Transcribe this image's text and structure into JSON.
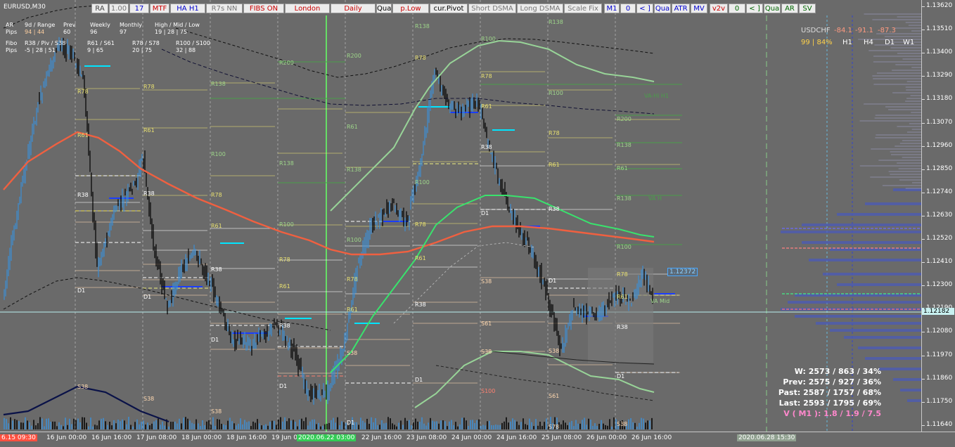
{
  "symbol": {
    "label": "EURUSD,M30"
  },
  "toolbar": [
    {
      "label": "RA",
      "color": "#444444"
    },
    {
      "label": "1.00",
      "color": "#777777"
    },
    {
      "label": "17",
      "color": "#0000cc"
    },
    {
      "label": "MTF",
      "color": "#cc0000"
    },
    {
      "label": "HA H1",
      "color": "#0000cc"
    },
    {
      "label": "R7s NN",
      "color": "#777777"
    },
    {
      "label": "FIBS ON",
      "color": "#cc0000"
    },
    {
      "label": "London",
      "color": "#cc0000"
    },
    {
      "label": "Daily",
      "color": "#cc0000"
    },
    {
      "label": "Qua",
      "color": "#000000"
    },
    {
      "label": "p.Low",
      "color": "#cc0000"
    },
    {
      "label": "cur.Pivot",
      "color": "#000000"
    },
    {
      "label": "Short DSMA",
      "color": "#777777"
    },
    {
      "label": "Long DSMA",
      "color": "#777777"
    },
    {
      "label": "Scale Fix",
      "color": "#777777"
    },
    {
      "label": "M1",
      "color": "#0000cc"
    },
    {
      "label": "0",
      "color": "#0000cc"
    },
    {
      "label": "< ]",
      "color": "#0000cc"
    },
    {
      "label": "Qua",
      "color": "#0000cc"
    },
    {
      "label": "ATR",
      "color": "#0000cc"
    },
    {
      "label": "MV",
      "color": "#0000cc"
    },
    {
      "label": "v2v",
      "color": "#cc0000"
    },
    {
      "label": "0",
      "color": "#006600"
    },
    {
      "label": "< ]",
      "color": "#006600"
    },
    {
      "label": "Qua",
      "color": "#006600"
    },
    {
      "label": "AR",
      "color": "#006600"
    },
    {
      "label": "SV",
      "color": "#006600"
    }
  ],
  "info_panel": {
    "row1": {
      "a": "AR",
      "b": "9d / Range",
      "c": "Prev",
      "d": "Weekly",
      "e": "Monthly",
      "f": "High / Mid / Low"
    },
    "row2": {
      "a": "Pips",
      "b": "94 | 44",
      "c": "60",
      "d": "96",
      "e": "97",
      "f": "19 | 28 | 75"
    },
    "row3": {
      "a": "Fibo",
      "b": "R38 / Piv / S38",
      "c": "R61 / S61",
      "d": "R78 / S78",
      "e": "R100 / S100"
    },
    "row4": {
      "a": "Pips",
      "b": "-5 | 28 | 51",
      "c": "9 | 65",
      "d": "20 | 75",
      "e": "32 | 88"
    }
  },
  "usdchf": {
    "symbol": "USDCHF",
    "v1": "-84.1",
    "v2": "-91.1",
    "v3": "-87.3",
    "pct": "99 | 84%",
    "tf": [
      "H1",
      "H4",
      "D1",
      "W1"
    ]
  },
  "stats": {
    "w": "W: 2573 / 863 / 34%",
    "prev": "Prev: 2575 / 927 / 36%",
    "past": "Past: 2587 / 1757 / 68%",
    "last": "Last: 2593 / 1795 / 69%",
    "vm1": "V ( M1 ): 1.8 / 1.9 / 7.5"
  },
  "price_scale": [
    "1.13620",
    "1.13510",
    "1.13400",
    "1.13290",
    "1.13180",
    "1.13070",
    "1.12960",
    "1.12850",
    "1.12740",
    "1.12630",
    "1.12520",
    "1.12410",
    "1.12300",
    "1.12190",
    "1.12080",
    "1.11970",
    "1.11860",
    "1.11750",
    "1.11640"
  ],
  "current_price": "1.12182",
  "box_price": "1.12372",
  "time_scale": [
    {
      "label": "6.15 09:30",
      "flag": "red"
    },
    {
      "label": "16 Jun 00:00"
    },
    {
      "label": "16 Jun 16:00"
    },
    {
      "label": "17 Jun 08:00"
    },
    {
      "label": "18 Jun 00:00"
    },
    {
      "label": "18 Jun 16:00"
    },
    {
      "label": "19 Jun 08:00"
    },
    {
      "label": "2020.06.22 03:00",
      "flag": "green"
    },
    {
      "label": "22 Jun 16:00"
    },
    {
      "label": "23 Jun 08:00"
    },
    {
      "label": "24 Jun 00:00"
    },
    {
      "label": "24 Jun 16:00"
    },
    {
      "label": "25 Jun 08:00"
    },
    {
      "label": "26 Jun 00:00"
    },
    {
      "label": "26 Jun 16:00"
    },
    {
      "label": "2020.06.28 15:30",
      "flag": "gray"
    }
  ],
  "level_labels": [
    "R100",
    "R78",
    "R61",
    "R38",
    "D1",
    "S38",
    "S61",
    "S78",
    "S100",
    "R138",
    "R200",
    "VA Mid",
    "VA H",
    "VA-Hi H1"
  ],
  "colors": {
    "bg": "#6a6a6a",
    "up": "#3d8fd6",
    "down": "#000000",
    "ema": "#f06040",
    "band": "#98d498",
    "green": "#39e36d"
  }
}
